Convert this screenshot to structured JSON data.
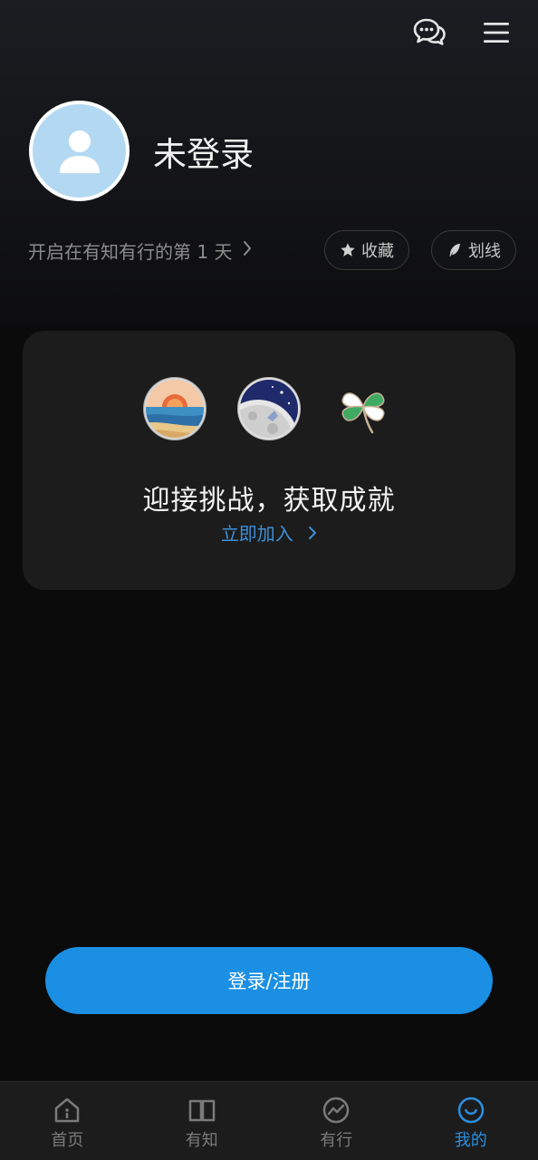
{
  "header": {
    "icons": [
      "chat-bubbles-icon",
      "menu-icon"
    ]
  },
  "profile": {
    "username": "未登录",
    "days_text": "开启在有知有行的第 1 天",
    "chevron": "›",
    "pills": [
      {
        "icon": "star-icon",
        "label": "收藏"
      },
      {
        "icon": "feather-icon",
        "label": "划线"
      }
    ]
  },
  "achievement_card": {
    "title": "迎接挑战，获取成就",
    "link_label": "立即加入",
    "link_chevron": "›",
    "badges": [
      "sunset-badge",
      "moon-badge",
      "clover-badge"
    ]
  },
  "login_button": {
    "label": "登录/注册"
  },
  "tabbar": {
    "tabs": [
      {
        "label": "首页",
        "icon": "home-icon",
        "active": false
      },
      {
        "label": "有知",
        "icon": "book-icon",
        "active": false
      },
      {
        "label": "有行",
        "icon": "trend-icon",
        "active": false
      },
      {
        "label": "我的",
        "icon": "smile-icon",
        "active": true
      }
    ]
  },
  "colors": {
    "accent": "#1a8fe3",
    "link": "#3d8fd6",
    "background": "#0b0b0b",
    "card": "#1c1c1d",
    "avatar_bg": "#b3d9f2"
  }
}
